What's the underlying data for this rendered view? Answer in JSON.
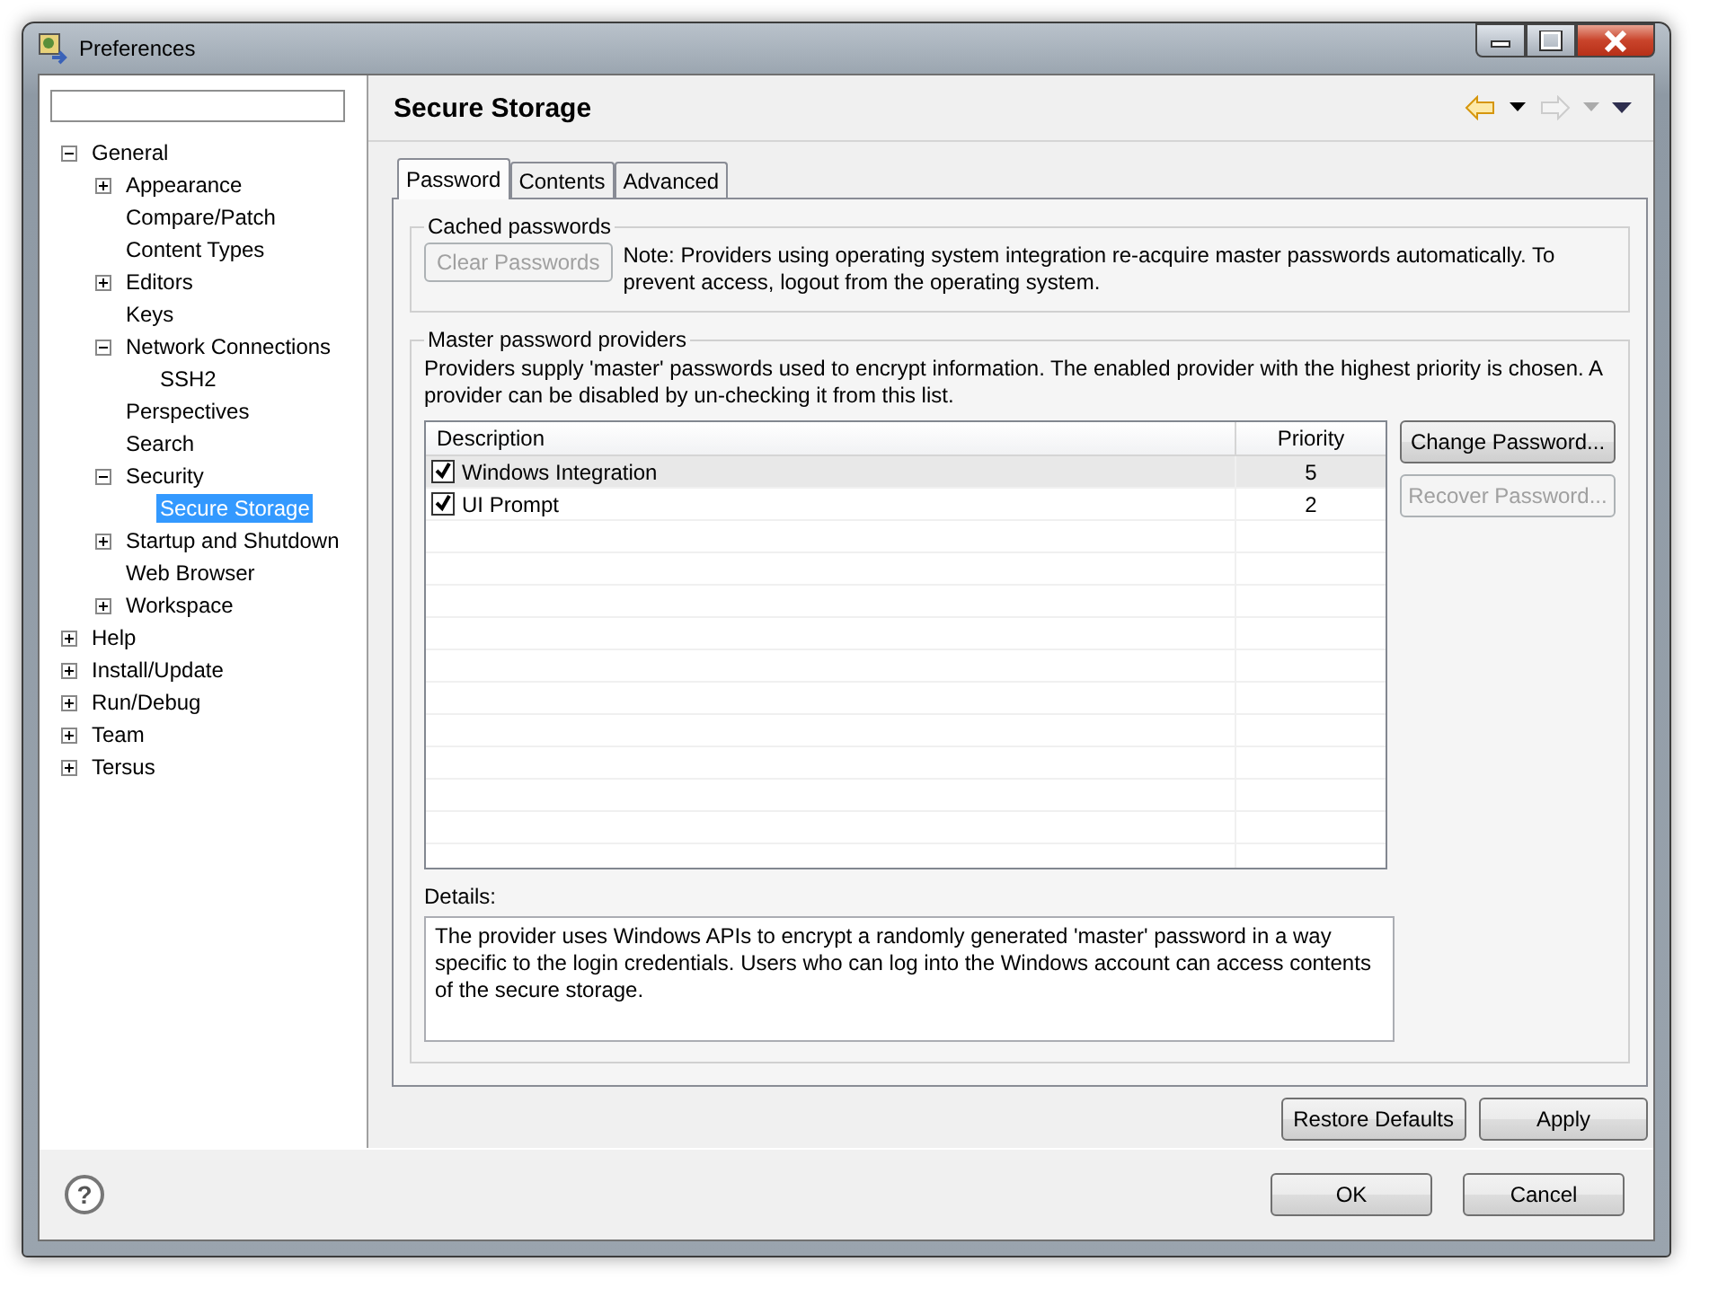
{
  "window": {
    "title": "Preferences"
  },
  "tree": [
    {
      "label": "General",
      "expanded": true,
      "selected": false,
      "children": [
        {
          "label": "Appearance",
          "expanded": false,
          "selected": false
        },
        {
          "label": "Compare/Patch",
          "selected": false
        },
        {
          "label": "Content Types",
          "selected": false
        },
        {
          "label": "Editors",
          "expanded": false,
          "selected": false
        },
        {
          "label": "Keys",
          "selected": false
        },
        {
          "label": "Network Connections",
          "expanded": true,
          "selected": false,
          "children": [
            {
              "label": "SSH2",
              "selected": false
            }
          ]
        },
        {
          "label": "Perspectives",
          "selected": false
        },
        {
          "label": "Search",
          "selected": false
        },
        {
          "label": "Security",
          "expanded": true,
          "selected": false,
          "children": [
            {
              "label": "Secure Storage",
              "selected": true
            }
          ]
        },
        {
          "label": "Startup and Shutdown",
          "expanded": false,
          "selected": false
        },
        {
          "label": "Web Browser",
          "selected": false
        },
        {
          "label": "Workspace",
          "expanded": false,
          "selected": false
        }
      ]
    },
    {
      "label": "Help",
      "expanded": false,
      "selected": false
    },
    {
      "label": "Install/Update",
      "expanded": false,
      "selected": false
    },
    {
      "label": "Run/Debug",
      "expanded": false,
      "selected": false
    },
    {
      "label": "Team",
      "expanded": false,
      "selected": false
    },
    {
      "label": "Tersus",
      "expanded": false,
      "selected": false
    }
  ],
  "page": {
    "title": "Secure Storage",
    "back_enabled": true,
    "forward_enabled": false
  },
  "tabs": [
    {
      "label": "Password",
      "selected": true
    },
    {
      "label": "Contents",
      "selected": false
    },
    {
      "label": "Advanced",
      "selected": false
    }
  ],
  "cached": {
    "title": "Cached passwords",
    "button": {
      "label": "Clear Passwords",
      "disabled": true
    },
    "note": "Note: Providers using operating system integration re-acquire master passwords automatically. To prevent access, logout from the operating system."
  },
  "providers": {
    "title": "Master password providers",
    "intro": "Providers supply 'master' passwords used to encrypt information. The enabled provider with the highest priority is chosen. A provider can be disabled by un-checking it from this list.",
    "columns": [
      "Description",
      "Priority"
    ],
    "rows": [
      {
        "description": "Windows Integration",
        "priority": "5",
        "checked": true,
        "selected": true
      },
      {
        "description": "UI Prompt",
        "priority": "2",
        "checked": true,
        "selected": false
      }
    ],
    "buttons": [
      {
        "label": "Change Password...",
        "disabled": false
      },
      {
        "label": "Recover Password...",
        "disabled": true
      }
    ],
    "details_label": "Details:",
    "details": "The provider uses Windows APIs to encrypt a randomly generated 'master' password in a way specific to the login credentials. Users who can log into the Windows account can access contents of the secure storage."
  },
  "page_buttons": [
    "Restore Defaults",
    "Apply"
  ],
  "help_button": {
    "label": "?"
  },
  "dialog_buttons": [
    "OK",
    "Cancel"
  ]
}
